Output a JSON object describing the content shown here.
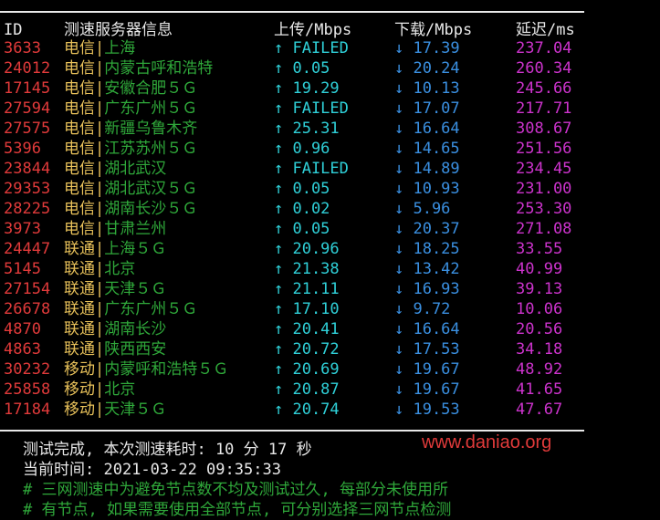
{
  "header": {
    "id": "ID",
    "name": "测速服务器信息",
    "up": "上传/Mbps",
    "down": "下载/Mbps",
    "latency": "延迟/ms"
  },
  "rows": [
    {
      "id": "3633",
      "isp": "电信",
      "city": "上海",
      "up": "↑ FAILED",
      "down": "↓ 17.39",
      "lat": "237.04"
    },
    {
      "id": "24012",
      "isp": "电信",
      "city": "内蒙古呼和浩特",
      "up": "↑ 0.05",
      "down": "↓ 20.24",
      "lat": "260.34"
    },
    {
      "id": "17145",
      "isp": "电信",
      "city": "安徽合肥５Ｇ",
      "up": "↑ 19.29",
      "down": "↓ 10.13",
      "lat": "245.66"
    },
    {
      "id": "27594",
      "isp": "电信",
      "city": "广东广州５Ｇ",
      "up": "↑ FAILED",
      "down": "↓ 17.07",
      "lat": "217.71"
    },
    {
      "id": "27575",
      "isp": "电信",
      "city": "新疆乌鲁木齐",
      "up": "↑ 25.31",
      "down": "↓ 16.64",
      "lat": "308.67"
    },
    {
      "id": "5396",
      "isp": "电信",
      "city": "江苏苏州５Ｇ",
      "up": "↑ 0.96",
      "down": "↓ 14.65",
      "lat": "251.56"
    },
    {
      "id": "23844",
      "isp": "电信",
      "city": "湖北武汉",
      "up": "↑ FAILED",
      "down": "↓ 14.89",
      "lat": "234.45"
    },
    {
      "id": "29353",
      "isp": "电信",
      "city": "湖北武汉５Ｇ",
      "up": "↑ 0.05",
      "down": "↓ 10.93",
      "lat": "231.00"
    },
    {
      "id": "28225",
      "isp": "电信",
      "city": "湖南长沙５Ｇ",
      "up": "↑ 0.02",
      "down": "↓ 5.96",
      "lat": "253.30"
    },
    {
      "id": "3973",
      "isp": "电信",
      "city": "甘肃兰州",
      "up": "↑ 0.05",
      "down": "↓ 20.37",
      "lat": "271.08"
    },
    {
      "id": "24447",
      "isp": "联通",
      "city": "上海５Ｇ",
      "up": "↑ 20.96",
      "down": "↓ 18.25",
      "lat": "33.55"
    },
    {
      "id": "5145",
      "isp": "联通",
      "city": "北京",
      "up": "↑ 21.38",
      "down": "↓ 13.42",
      "lat": "40.99"
    },
    {
      "id": "27154",
      "isp": "联通",
      "city": "天津５Ｇ",
      "up": "↑ 21.11",
      "down": "↓ 16.93",
      "lat": "39.13"
    },
    {
      "id": "26678",
      "isp": "联通",
      "city": "广东广州５Ｇ",
      "up": "↑ 17.10",
      "down": "↓ 9.72",
      "lat": "10.06"
    },
    {
      "id": "4870",
      "isp": "联通",
      "city": "湖南长沙",
      "up": "↑ 20.41",
      "down": "↓ 16.64",
      "lat": "20.56"
    },
    {
      "id": "4863",
      "isp": "联通",
      "city": "陕西西安",
      "up": "↑ 20.72",
      "down": "↓ 17.53",
      "lat": "34.18"
    },
    {
      "id": "30232",
      "isp": "移动",
      "city": "内蒙呼和浩特５Ｇ",
      "up": "↑ 20.69",
      "down": "↓ 19.67",
      "lat": "48.92"
    },
    {
      "id": "25858",
      "isp": "移动",
      "city": "北京",
      "up": "↑ 20.87",
      "down": "↓ 19.67",
      "lat": "41.65"
    },
    {
      "id": "17184",
      "isp": "移动",
      "city": "天津５Ｇ",
      "up": "↑ 20.74",
      "down": "↓ 19.53",
      "lat": "47.67"
    }
  ],
  "footer": {
    "done": "测试完成, 本次测速耗时: 10 分 17 秒",
    "time": "当前时间: 2021-03-22 09:35:33",
    "comment1": "# 三网测速中为避免节点数不均及测试过久, 每部分未使用所",
    "comment2": "# 有节点, 如果需要使用全部节点, 可分别选择三网节点检测"
  },
  "watermark": "www.daniao.org",
  "colors": {
    "background": "#000000",
    "id": "#e03a3a",
    "isp": "#e8c15a",
    "city": "#2fa83a",
    "upload": "#2fd0d8",
    "download": "#3a8fe0",
    "latency": "#cc33cc"
  }
}
